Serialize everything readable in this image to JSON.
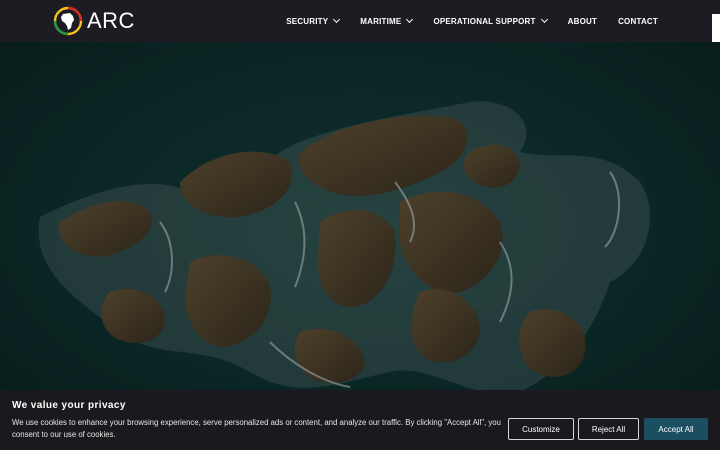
{
  "header": {
    "logo_text": "ARC",
    "nav": [
      {
        "label": "SECURITY",
        "has_dropdown": true
      },
      {
        "label": "MARITIME",
        "has_dropdown": true
      },
      {
        "label": "OPERATIONAL SUPPORT",
        "has_dropdown": true
      },
      {
        "label": "ABOUT",
        "has_dropdown": false
      },
      {
        "label": "CONTACT",
        "has_dropdown": false
      }
    ]
  },
  "hero": {
    "icon": "aerial-coastline-photo"
  },
  "cookie_banner": {
    "title": "We value your privacy",
    "text": "We use cookies to enhance your browsing experience, serve personalized ads or content, and analyze our traffic. By clicking \"Accept All\", you consent to our use of cookies.",
    "customize_label": "Customize",
    "reject_label": "Reject All",
    "accept_label": "Accept All"
  },
  "colors": {
    "header_bg": "#1d1c22",
    "accent_button": "#1b4e61",
    "logo_ring_red": "#d62a24",
    "logo_ring_yellow": "#f5c518",
    "logo_ring_green": "#1e9a45"
  }
}
